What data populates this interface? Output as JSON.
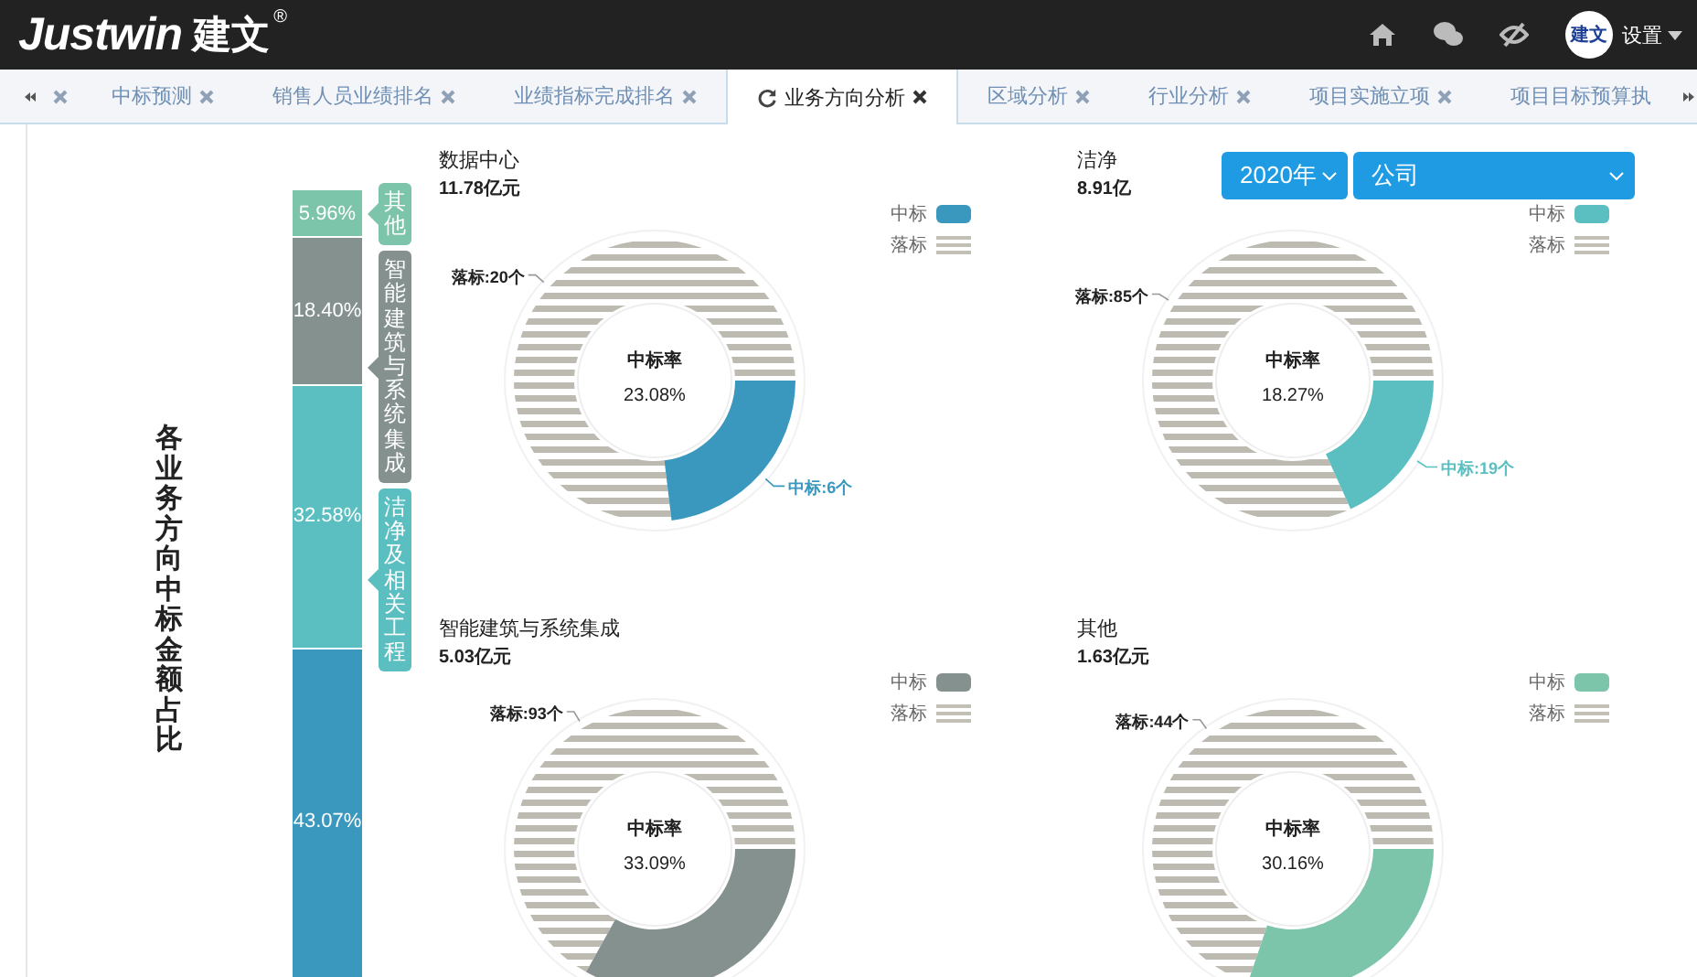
{
  "header": {
    "logo": "Justwin",
    "logo_cn": "建文",
    "registered": "®",
    "avatar_text": "建文",
    "settings": "设置"
  },
  "tabs": [
    {
      "selected": false,
      "closable": true
    },
    {
      "label": "中标预测",
      "selected": false,
      "closable": true
    },
    {
      "label": "销售人员业绩排名",
      "selected": false,
      "closable": true
    },
    {
      "label": "业绩指标完成排名",
      "selected": false,
      "closable": true
    },
    {
      "label": "业务方向分析",
      "selected": true,
      "closable": true
    },
    {
      "label": "区域分析",
      "selected": false,
      "closable": true
    },
    {
      "label": "行业分析",
      "selected": false,
      "closable": true
    },
    {
      "label": "项目实施立项",
      "selected": false,
      "closable": true
    },
    {
      "label": "项目目标预算执",
      "selected": false,
      "closable": false
    }
  ],
  "filters": [
    {
      "value": "2020年"
    },
    {
      "value": "公司"
    }
  ],
  "overview": {
    "title": "各业务方向中标金额占比",
    "chart_data": {
      "type": "bar",
      "stacked": true,
      "orientation": "vertical",
      "legend": "right",
      "series": [
        {
          "color": "#3a97be",
          "values": [
            43.07
          ],
          "value_labels": [
            "43.07%"
          ]
        },
        {
          "name": "洁净及相关工程",
          "color": "#5bbfc1",
          "values": [
            32.58
          ],
          "value_labels": [
            "32.58%"
          ]
        },
        {
          "name": "智能建筑与系统集成",
          "color": "#84918f",
          "values": [
            18.4
          ],
          "value_labels": [
            "18.40%"
          ]
        },
        {
          "name": "其他",
          "color": "#7cc4aa",
          "values": [
            5.96
          ],
          "value_labels": [
            "5.96%"
          ]
        }
      ]
    }
  },
  "panels": [
    {
      "title": "数据中心",
      "amount": "11.78亿元",
      "color": "#3a97be",
      "center_label": "中标率",
      "rate": "23.08%",
      "callouts": [
        {
          "kind": "lost",
          "text": "落标:20个"
        },
        {
          "kind": "won",
          "text": "中标:6个"
        }
      ],
      "chart_data": {
        "type": "donut",
        "categories": [
          "中标",
          "落标"
        ],
        "values": [
          23.08,
          76.92
        ]
      }
    },
    {
      "title": "洁净",
      "amount": "8.91亿",
      "color": "#5bbfc1",
      "center_label": "中标率",
      "rate": "18.27%",
      "callouts": [
        {
          "kind": "lost",
          "text": "落标:85个"
        },
        {
          "kind": "won",
          "text": "中标:19个"
        }
      ],
      "chart_data": {
        "type": "donut",
        "categories": [
          "中标",
          "落标"
        ],
        "values": [
          18.27,
          81.73
        ]
      }
    },
    {
      "title": "智能建筑与系统集成",
      "amount": "5.03亿元",
      "color": "#84918f",
      "center_label": "中标率",
      "rate": "33.09%",
      "callouts": [
        {
          "kind": "lost",
          "text": "落标:93个"
        }
      ],
      "chart_data": {
        "type": "donut",
        "categories": [
          "中标",
          "落标"
        ],
        "values": [
          33.09,
          66.91
        ]
      }
    },
    {
      "title": "其他",
      "amount": "1.63亿元",
      "color": "#7cc4aa",
      "center_label": "中标率",
      "rate": "30.16%",
      "callouts": [
        {
          "kind": "lost",
          "text": "落标:44个"
        }
      ],
      "chart_data": {
        "type": "donut",
        "categories": [
          "中标",
          "落标"
        ],
        "values": [
          30.16,
          69.84
        ]
      }
    }
  ]
}
